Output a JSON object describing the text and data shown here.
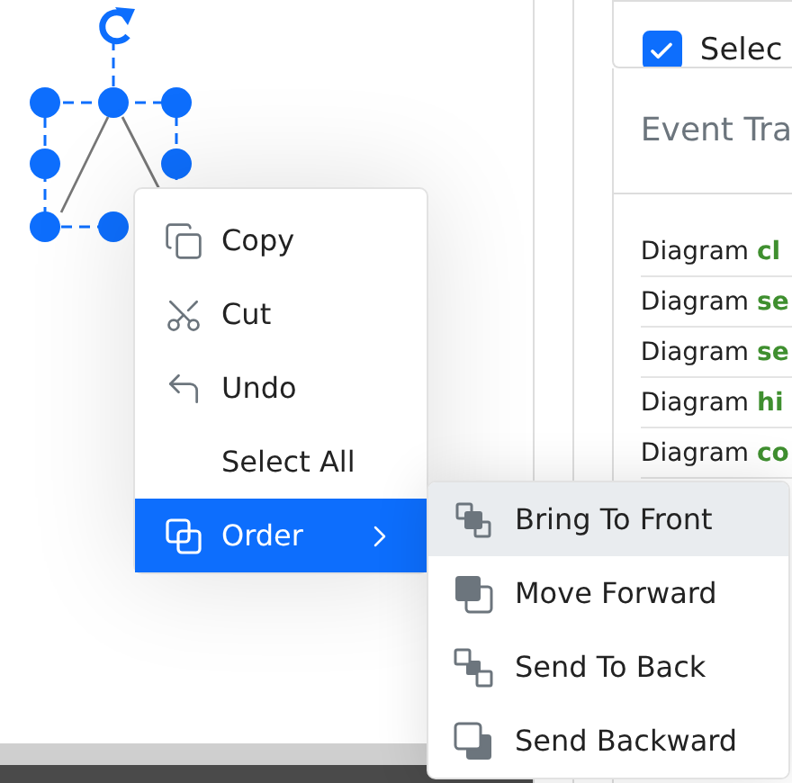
{
  "panel": {
    "checkbox": {
      "label": "Selec",
      "checked": true
    },
    "event_trace": {
      "title": "Event Tra",
      "rows": [
        {
          "prefix": "Diagram",
          "event": "cl"
        },
        {
          "prefix": "Diagram",
          "event": "se"
        },
        {
          "prefix": "Diagram",
          "event": "se"
        },
        {
          "prefix": "Diagram",
          "event": "hi"
        },
        {
          "prefix": "Diagram",
          "event": "co"
        }
      ]
    }
  },
  "context_menu": {
    "items": [
      {
        "label": "Copy",
        "kind": "copy",
        "selected": false,
        "submenu": false
      },
      {
        "label": "Cut",
        "kind": "cut",
        "selected": false,
        "submenu": false
      },
      {
        "label": "Undo",
        "kind": "undo",
        "selected": false,
        "submenu": false
      },
      {
        "label": "Select All",
        "kind": "none",
        "selected": false,
        "submenu": false
      },
      {
        "label": "Order",
        "kind": "order",
        "selected": true,
        "submenu": true
      }
    ]
  },
  "submenu": {
    "items": [
      {
        "label": "Bring To Front",
        "kind": "bring-to-front",
        "selected": true
      },
      {
        "label": "Move Forward",
        "kind": "move-forward",
        "selected": false
      },
      {
        "label": "Send To Back",
        "kind": "send-to-back",
        "selected": false
      },
      {
        "label": "Send Backward",
        "kind": "send-backward",
        "selected": false
      }
    ]
  }
}
